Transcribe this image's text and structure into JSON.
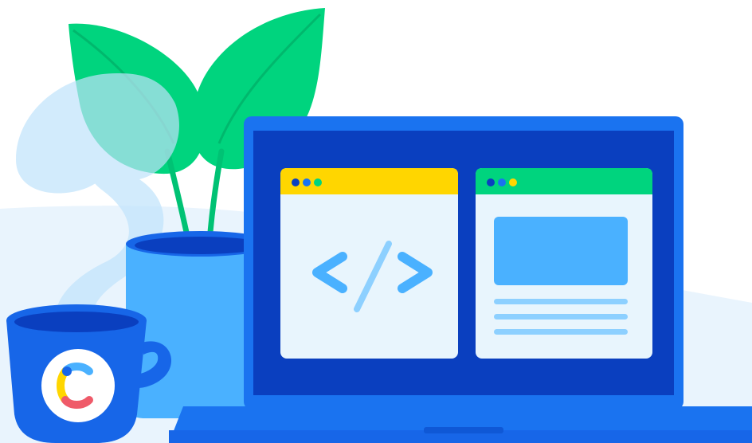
{
  "illustration": {
    "colors": {
      "background": "#ffffff",
      "floor": "#e9f4fd",
      "laptop_body": "#1a73f0",
      "laptop_screen": "#0a3fbf",
      "window_bg": "#e8f5fd",
      "code_window_bar": "#ffd600",
      "preview_window_bar": "#00d47e",
      "accent_light_blue": "#4ab1ff",
      "plant_leaf": "#00d47e",
      "pot": "#3b9bf5",
      "mug": "#1766e8",
      "logo_yellow": "#ffd600",
      "logo_blue": "#4ab1ff",
      "logo_red": "#ef5a69"
    },
    "code_window": {
      "icon": "code-brackets-icon"
    },
    "preview_window": {
      "icon": "layout-preview-icon"
    },
    "mug": {
      "icon": "logo-c-icon"
    }
  }
}
